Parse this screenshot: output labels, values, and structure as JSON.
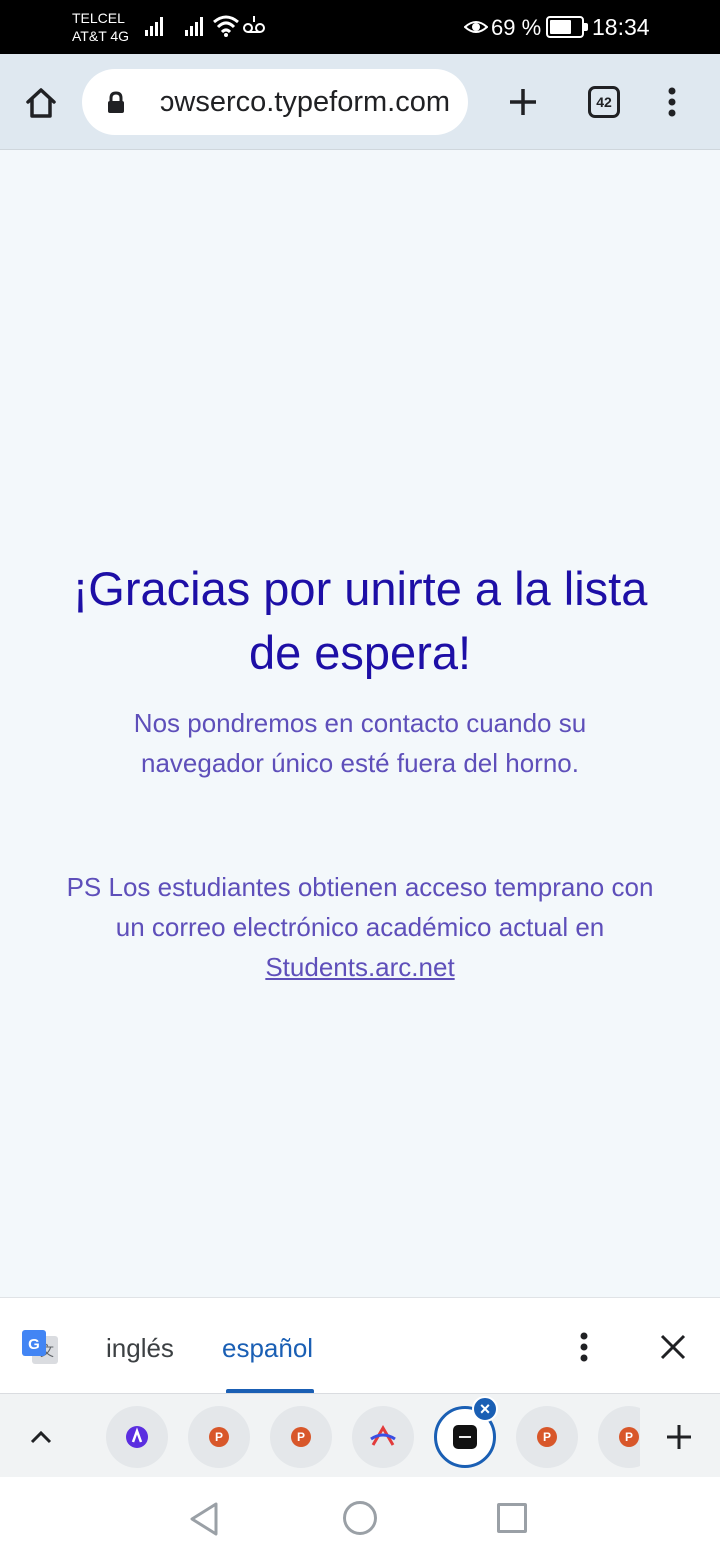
{
  "status_bar": {
    "carrier_1": "TELCEL",
    "carrier_2": "AT&T 4G",
    "battery_percent": "69 %",
    "battery_level": 0.69,
    "time": "18:34",
    "icons": [
      "signal-icon",
      "signal-icon",
      "wifi-icon",
      "voicemail-icon",
      "eye-icon",
      "battery-icon"
    ]
  },
  "toolbar": {
    "url": "ɔwserco.typeform.com",
    "tab_count": "42",
    "icons": [
      "home-icon",
      "lock-icon",
      "plus-icon",
      "tab-switcher-icon",
      "more-vert-icon"
    ]
  },
  "page": {
    "headline": "¡Gracias por unirte a la lista de espera!",
    "subtitle": "Nos pondremos en contacto cuando su navegador único esté fuera del horno.",
    "ps_text": "PS Los estudiantes obtienen acceso temprano con un correo electrónico académico actual en",
    "ps_link": "Students.arc.net",
    "colors": {
      "headline": "#1d0fa6",
      "body": "#5e4fba",
      "background": "#f3f8fb"
    }
  },
  "translate_bar": {
    "source_language": "inglés",
    "target_language": "español",
    "accent": "#1a5fb4"
  },
  "tab_strip": {
    "favicons": [
      "arc-favicon",
      "p-favicon",
      "p-favicon",
      "arc-favicon",
      "current-tab-favicon",
      "p-favicon",
      "p-favicon"
    ],
    "favicon_letter": "P"
  },
  "nav_bar": {
    "icons": [
      "back-icon",
      "home-circle-icon",
      "recents-icon"
    ]
  }
}
